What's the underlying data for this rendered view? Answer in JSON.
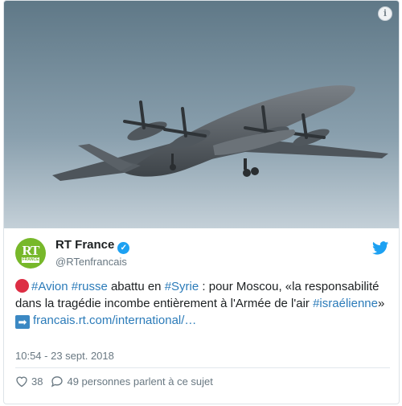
{
  "tweet": {
    "author_name": "RT France",
    "author_handle": "@RTenfrancais",
    "logo_text": "RT",
    "logo_sub": "FRANCE",
    "text": {
      "tag1": "#Avion",
      "tag2": "#russe",
      "part1": " abattu en ",
      "tag3": "#Syrie",
      "part2": " : pour Moscou, «la responsabilité dans la tragédie incombe entièrement à l'Armée de l'air ",
      "tag4": "#israélienne",
      "part3": "»",
      "link": "francais.rt.com/international/…"
    },
    "timestamp": "10:54 - 23 sept. 2018",
    "likes": "38",
    "replies": "49 personnes parlent à ce sujet",
    "info_glyph": "i"
  },
  "colors": {
    "accent": "#1da1f2",
    "link": "#2b7bb9",
    "brand": "#77b82a"
  }
}
